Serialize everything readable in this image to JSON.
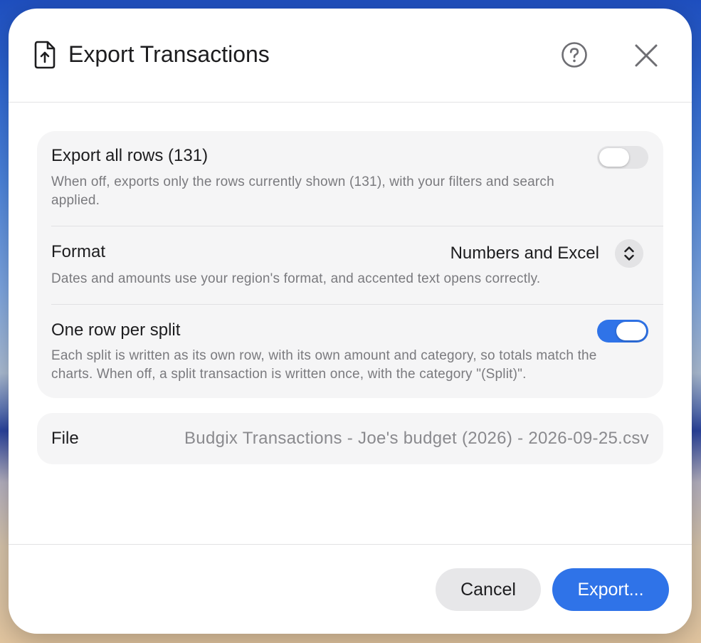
{
  "dialog": {
    "title": "Export Transactions",
    "icons": {
      "document": "doc-export-icon",
      "help": "question-circle-icon",
      "close": "close-icon"
    }
  },
  "options": {
    "export_all": {
      "title": "Export all rows (131)",
      "description": "When off, exports only the rows currently shown (131), with your filters and search applied.",
      "enabled": false
    },
    "format": {
      "title": "Format",
      "value": "Numbers and Excel",
      "description": "Dates and amounts use your region's format, and accented text opens correctly."
    },
    "split": {
      "title": "One row per split",
      "description": "Each split is written as its own row, with its own amount and category, so totals match the charts. When off, a split transaction is written once, with the category \"(Split)\".",
      "enabled": true
    }
  },
  "file": {
    "label": "File",
    "value": "Budgix Transactions - Joe's budget (2026) - 2026-09-25.csv"
  },
  "footer": {
    "cancel_label": "Cancel",
    "export_label": "Export..."
  },
  "colors": {
    "accent": "#2f73e8",
    "toggle_off": "#e4e4e6"
  }
}
